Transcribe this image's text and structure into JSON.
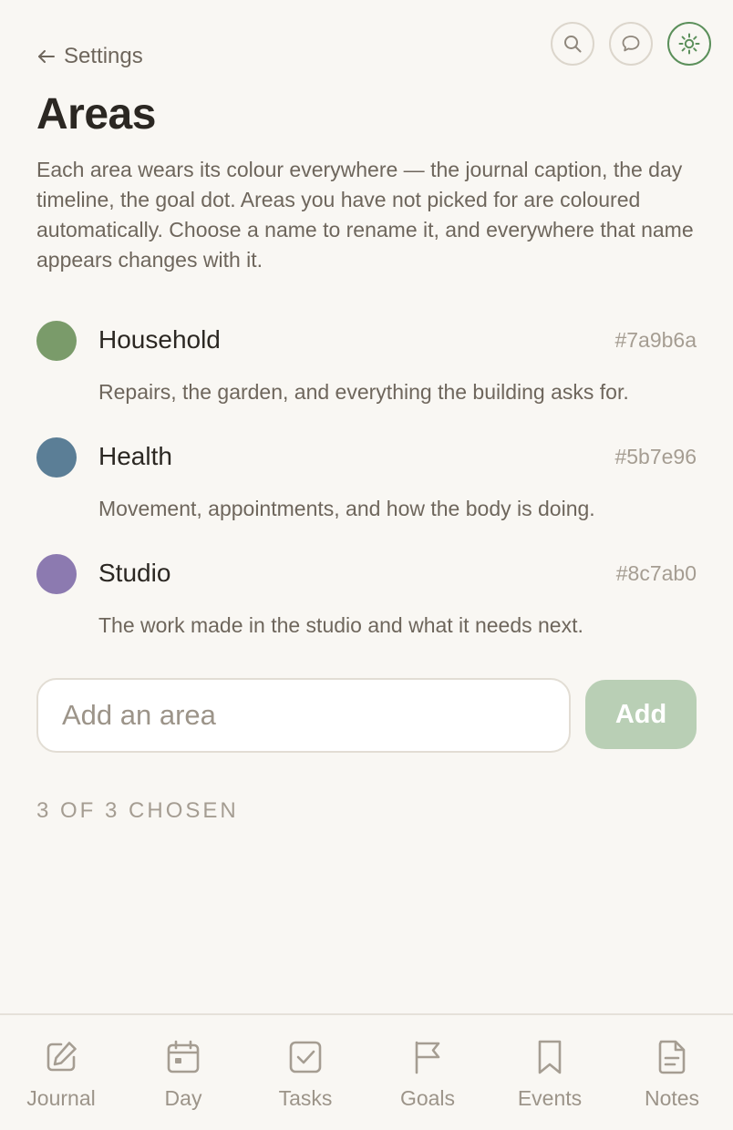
{
  "header": {
    "back_label": "Settings",
    "title": "Areas",
    "description": "Each area wears its colour everywhere — the journal caption, the day timeline, the goal dot. Areas you have not picked for are coloured automatically. Choose a name to rename it, and everywhere that name appears changes with it.",
    "icons": [
      "search-icon",
      "comment-icon",
      "sun-icon"
    ]
  },
  "areas": [
    {
      "name": "Household",
      "hex": "#7a9b6a",
      "description": "Repairs, the garden, and everything the building asks for."
    },
    {
      "name": "Health",
      "hex": "#5b7e96",
      "description": "Movement, appointments, and how the body is doing."
    },
    {
      "name": "Studio",
      "hex": "#8c7ab0",
      "description": "The work made in the studio and what it needs next."
    }
  ],
  "add_form": {
    "value": "",
    "placeholder": "Add an area",
    "button_label": "Add"
  },
  "count_label": "3 OF 3 CHOSEN",
  "nav": {
    "items": [
      {
        "label": "Journal",
        "icon": "pencil-square-icon"
      },
      {
        "label": "Day",
        "icon": "calendar-icon"
      },
      {
        "label": "Tasks",
        "icon": "checkbox-icon"
      },
      {
        "label": "Goals",
        "icon": "flag-icon"
      },
      {
        "label": "Events",
        "icon": "bookmark-icon"
      },
      {
        "label": "Notes",
        "icon": "document-icon"
      }
    ]
  },
  "colors": {
    "background": "#f9f7f3",
    "accent": "#5b8f5a",
    "add_button": "#b9cfb5",
    "muted_text": "#9c9489"
  }
}
